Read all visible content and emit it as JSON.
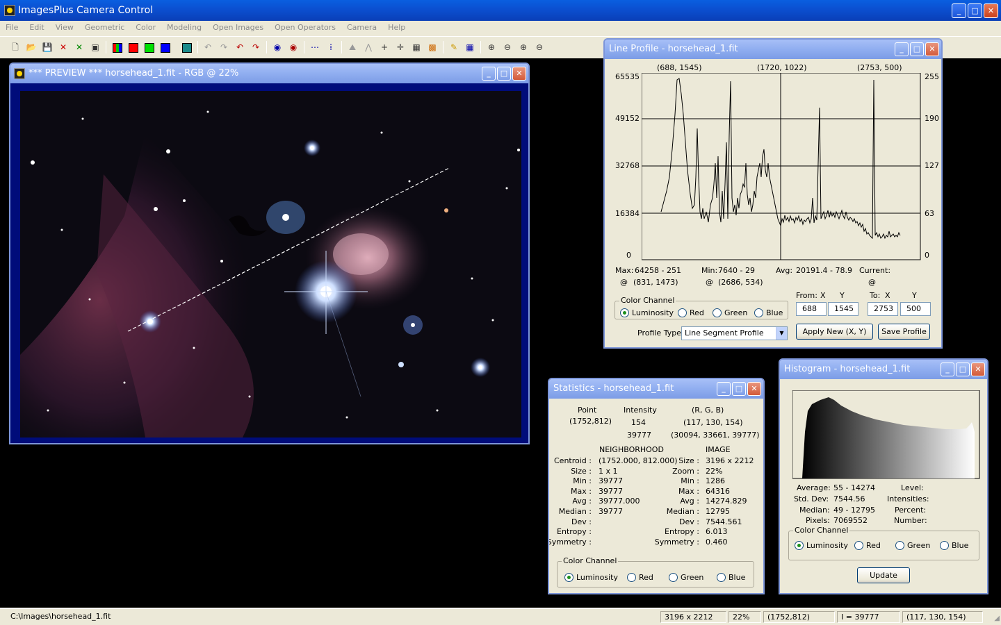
{
  "app": {
    "title": "ImagesPlus Camera Control"
  },
  "menu": [
    "File",
    "Edit",
    "View",
    "Geometric",
    "Color",
    "Modeling",
    "Open Images",
    "Open Operators",
    "Camera",
    "Help"
  ],
  "colors": {
    "red": "#ff0000",
    "green": "#00e000",
    "blue": "#0000ff",
    "teal": "#1a8a8a"
  },
  "preview": {
    "title": "*** PREVIEW *** horsehead_1.fit - RGB @ 22%"
  },
  "line_profile": {
    "title": "Line Profile - horsehead_1.fit",
    "top_labels": [
      "(688, 1545)",
      "(1720, 1022)",
      "(2753, 500)"
    ],
    "left_axis": [
      "65535",
      "49152",
      "32768",
      "16384",
      "0"
    ],
    "right_axis": [
      "255",
      "190",
      "127",
      "63",
      "0"
    ],
    "max_label": "Max:",
    "max_value": "64258 - 251",
    "max_at": "@",
    "max_pos": "(831, 1473)",
    "min_label": "Min:",
    "min_value": "7640 - 29",
    "min_at": "@",
    "min_pos": "(2686, 534)",
    "avg_label": "Avg:",
    "avg_value": "20191.4 -  78.9",
    "current_label": "Current:",
    "current_at": "@",
    "from_label": "From:",
    "to_label": "To:",
    "x_label": "X",
    "y_label": "Y",
    "from_x": "688",
    "from_y": "1545",
    "to_x": "2753",
    "to_y": "500",
    "color_channel": "Color Channel",
    "channels": [
      "Luminosity",
      "Red",
      "Green",
      "Blue"
    ],
    "profile_type_label": "Profile Type:",
    "profile_type_value": "Line Segment Profile",
    "apply_button": "Apply New (X, Y)",
    "save_button": "Save Profile"
  },
  "statistics": {
    "title": "Statistics - horsehead_1.fit",
    "hdr_point": "Point",
    "hdr_intensity": "Intensity",
    "hdr_rgb": "(R, G, B)",
    "point": "(1752,812)",
    "intensity1": "154",
    "rgb1": "(117, 130, 154)",
    "intensity2": "39777",
    "rgb2": "(30094, 33661, 39777)",
    "neighborhood": "NEIGHBORHOOD",
    "image": "IMAGE",
    "n_rows": [
      [
        "Centroid :",
        "(1752.000, 812.000)"
      ],
      [
        "Size :",
        "1 x 1"
      ],
      [
        "Min :",
        "39777"
      ],
      [
        "Max :",
        "39777"
      ],
      [
        "Avg :",
        "39777.000"
      ],
      [
        "Median :",
        "39777"
      ],
      [
        "Dev :",
        ""
      ],
      [
        "Entropy :",
        ""
      ],
      [
        "Symmetry :",
        ""
      ]
    ],
    "i_rows": [
      [
        "Size :",
        "3196 x 2212"
      ],
      [
        "Zoom :",
        "22%"
      ],
      [
        "Min :",
        "1286"
      ],
      [
        "Max :",
        "64316"
      ],
      [
        "Avg :",
        "14274.829"
      ],
      [
        "Median :",
        "12795"
      ],
      [
        "Dev :",
        "7544.561"
      ],
      [
        "Entropy :",
        "6.013"
      ],
      [
        "Symmetry :",
        "0.460"
      ]
    ],
    "color_channel": "Color Channel",
    "channels": [
      "Luminosity",
      "Red",
      "Green",
      "Blue"
    ]
  },
  "histogram": {
    "title": "Histogram - horsehead_1.fit",
    "average_label": "Average:",
    "average_value": "55 - 14274",
    "stddev_label": "Std. Dev:",
    "stddev_value": "7544.56",
    "median_label": "Median:",
    "median_value": "49 - 12795",
    "pixels_label": "Pixels:",
    "pixels_value": "7069552",
    "level_label": "Level:",
    "intensities_label": "Intensities:",
    "percent_label": "Percent:",
    "number_label": "Number:",
    "color_channel": "Color Channel",
    "channels": [
      "Luminosity",
      "Red",
      "Green",
      "Blue"
    ],
    "update_button": "Update"
  },
  "status": {
    "path": "C:\\Images\\horsehead_1.fit",
    "size": "3196 x 2212",
    "zoom": "22%",
    "point": "(1752,812)",
    "intensity": "I = 39777",
    "rgb": "(117, 130, 154)"
  }
}
